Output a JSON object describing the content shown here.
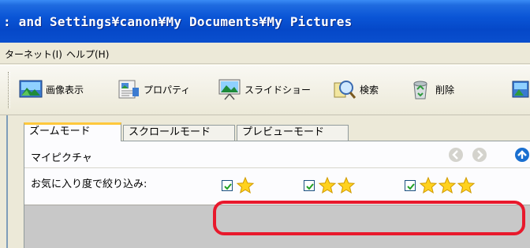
{
  "window": {
    "title": ": and Settings¥canon¥My Documents¥My Pictures"
  },
  "menu": {
    "items": [
      {
        "label": "ターネット(I)"
      },
      {
        "label": "ヘルプ(H)"
      }
    ]
  },
  "toolbar": {
    "buttons": [
      {
        "label": "画像表示",
        "icon": "landscape-image-icon"
      },
      {
        "label": "プロパティ",
        "icon": "properties-icon"
      },
      {
        "label": "スライドショー",
        "icon": "slideshow-icon"
      },
      {
        "label": "検索",
        "icon": "search-magnifier-icon"
      },
      {
        "label": "削除",
        "icon": "recycle-bin-icon"
      },
      {
        "label": "",
        "icon": "partial-tool-icon"
      }
    ]
  },
  "tabs": [
    {
      "label": "ズームモード",
      "active": true
    },
    {
      "label": "スクロールモード",
      "active": false
    },
    {
      "label": "プレビューモード",
      "active": false
    }
  ],
  "panel": {
    "album_label": "マイピクチャ",
    "nav": {
      "back": "back-arrow-icon",
      "forward": "forward-arrow-icon",
      "up": "up-arrow-icon"
    },
    "filter_label": "お気に入り度で絞り込み:",
    "filters": [
      {
        "stars": 1,
        "checked": true
      },
      {
        "stars": 2,
        "checked": true
      },
      {
        "stars": 3,
        "checked": true
      }
    ]
  },
  "colors": {
    "titlebar": "#0548c8",
    "highlight": "#e8192c",
    "star": "#ffd21e",
    "active_tab_accent": "#ffc83c"
  }
}
